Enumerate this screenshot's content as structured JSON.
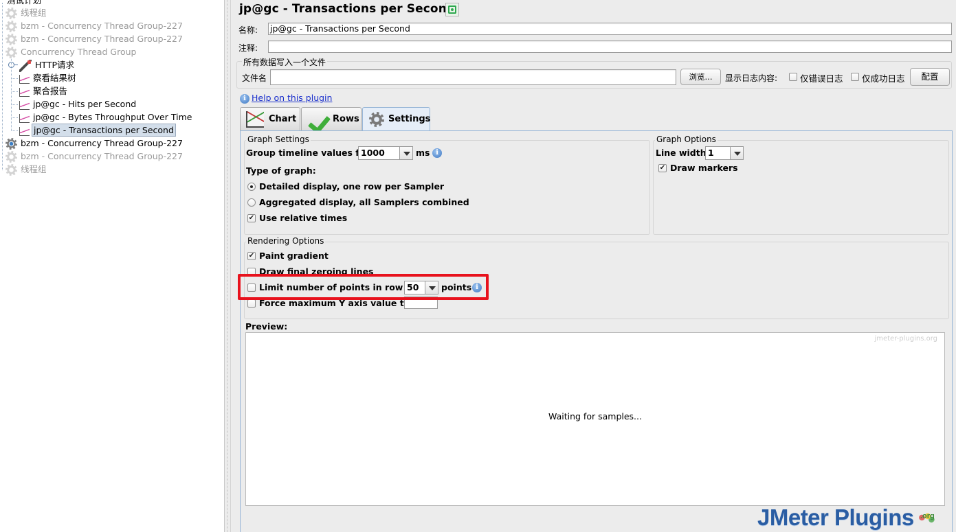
{
  "tree": {
    "root_label": "测试计划",
    "items": [
      {
        "label": "线程组",
        "icon": "gear-icon",
        "disabled": true
      },
      {
        "label": "bzm - Concurrency Thread Group-227",
        "icon": "gear-icon",
        "disabled": true
      },
      {
        "label": "bzm - Concurrency Thread Group-227",
        "icon": "gear-icon",
        "disabled": true
      },
      {
        "label": "Concurrency Thread Group",
        "icon": "gear-icon",
        "disabled": true
      },
      {
        "label": "HTTP请求",
        "icon": "sampler-pen-icon",
        "disabled": false
      },
      {
        "label": "察看结果树",
        "icon": "graph-listener-icon",
        "disabled": false
      },
      {
        "label": "聚合报告",
        "icon": "graph-listener-icon",
        "disabled": false
      },
      {
        "label": "jp@gc - Hits per Second",
        "icon": "graph-listener-icon",
        "disabled": false
      },
      {
        "label": "jp@gc - Bytes Throughput Over Time",
        "icon": "graph-listener-icon",
        "disabled": false
      },
      {
        "label": "jp@gc - Transactions per Second",
        "icon": "graph-listener-icon",
        "disabled": false,
        "selected": true
      },
      {
        "label": "bzm - Concurrency Thread Group-227",
        "icon": "gear-icon",
        "disabled": false
      },
      {
        "label": "bzm - Concurrency Thread Group-227",
        "icon": "gear-icon",
        "disabled": true
      },
      {
        "label": "线程组",
        "icon": "gear-icon",
        "disabled": true
      }
    ]
  },
  "panel": {
    "title": "jp@gc - Transactions per Second",
    "name_label": "名称:",
    "name_value": "jp@gc - Transactions per Second",
    "comment_label": "注释:",
    "comment_value": "",
    "file_group_title": "所有数据写入一个文件",
    "filename_label": "文件名",
    "filename_value": "",
    "browse_label": "浏览...",
    "log_label": "显示日志内容:",
    "errors_only_label": "仅错误日志",
    "success_only_label": "仅成功日志",
    "configure_label": "配置",
    "help_link": "Help on this plugin"
  },
  "tabs": [
    {
      "label": "Chart",
      "active": false
    },
    {
      "label": "Rows",
      "active": false
    },
    {
      "label": "Settings",
      "active": true
    }
  ],
  "settings": {
    "graph_settings_title": "Graph Settings",
    "group_timeline_label": "Group timeline values for",
    "group_timeline_value": "1000",
    "group_timeline_unit": "ms",
    "type_of_graph_label": "Type of graph:",
    "detailed_label": "Detailed display, one row per Sampler",
    "detailed_selected": true,
    "aggregated_label": "Aggregated display, all Samplers combined",
    "aggregated_selected": false,
    "relative_times_label": "Use relative times",
    "relative_times_checked": true,
    "graph_options_title": "Graph Options",
    "line_width_label": "Line width:",
    "line_width_value": "1",
    "draw_markers_label": "Draw markers",
    "draw_markers_checked": true,
    "rendering_title": "Rendering Options",
    "paint_gradient_label": "Paint gradient",
    "paint_gradient_checked": true,
    "zeroing_label": "Draw final zeroing lines",
    "zeroing_checked": false,
    "limit_points_label": "Limit number of points in row to",
    "limit_points_value": "50",
    "limit_points_unit": "points",
    "limit_points_checked": false,
    "force_max_y_label": "Force maximum Y axis value to",
    "force_max_y_value": "",
    "force_max_y_checked": false,
    "preview_label": "Preview:",
    "watermark": "jmeter-plugins.org",
    "waiting_text": "Waiting for samples..."
  },
  "logo": {
    "text": "JMeter Plugins",
    "suffix": ".org"
  },
  "colors": {
    "highlight": "#e8121d",
    "link": "#1a2fcc",
    "logo": "#2a5da3"
  }
}
